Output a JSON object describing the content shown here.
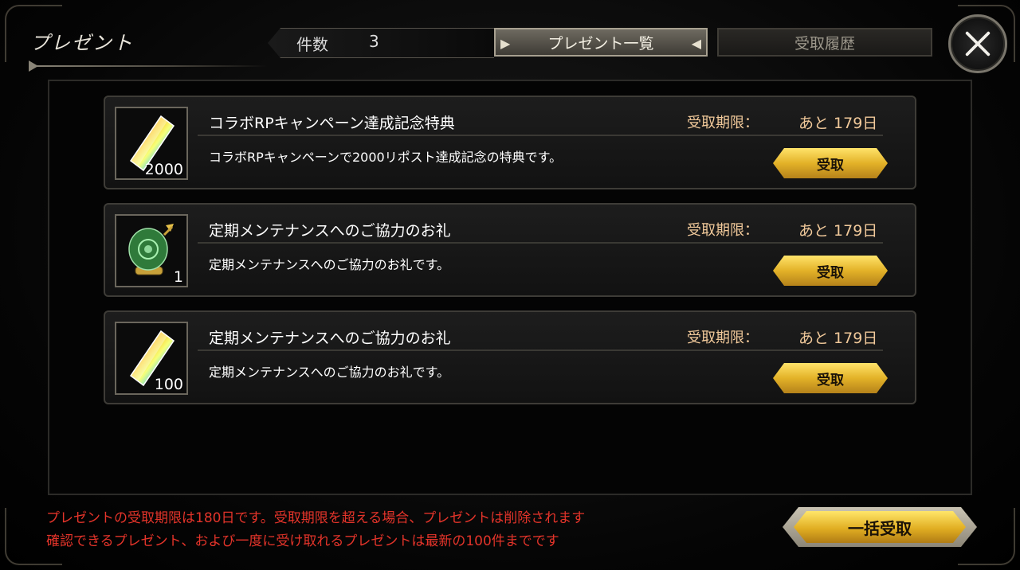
{
  "header": {
    "title": "プレゼント",
    "count_label": "件数",
    "count_value": "3",
    "tabs": [
      {
        "label": "プレゼント一覧",
        "active": true
      },
      {
        "label": "受取履歴",
        "active": false
      }
    ],
    "close_icon": "close-icon"
  },
  "items": [
    {
      "title": "コラボRPキャンペーン達成記念特典",
      "description": "コラボRPキャンペーンで2000リポスト達成記念の特典です。",
      "deadline_label": "受取期限：",
      "deadline_value": "あと 179日",
      "quantity": "2000",
      "icon": "crystal-icon",
      "button": "受取"
    },
    {
      "title": "定期メンテナンスへのご協力のお礼",
      "description": "定期メンテナンスへのご協力のお礼です。",
      "deadline_label": "受取期限：",
      "deadline_value": "あと 179日",
      "quantity": "1",
      "icon": "scroll-icon",
      "button": "受取"
    },
    {
      "title": "定期メンテナンスへのご協力のお礼",
      "description": "定期メンテナンスへのご協力のお礼です。",
      "deadline_label": "受取期限：",
      "deadline_value": "あと 179日",
      "quantity": "100",
      "icon": "crystal-icon",
      "button": "受取"
    }
  ],
  "footer": {
    "notice_line1": "プレゼントの受取期限は180日です。受取期限を超える場合、プレゼントは削除されます",
    "notice_line2": "確認できるプレゼント、および一度に受け取れるプレゼントは最新の100件までです",
    "bulk_button": "一括受取"
  },
  "colors": {
    "accent_gold": "#e3b228",
    "deadline_text": "#f1c99a",
    "notice_red": "#e4342a"
  }
}
